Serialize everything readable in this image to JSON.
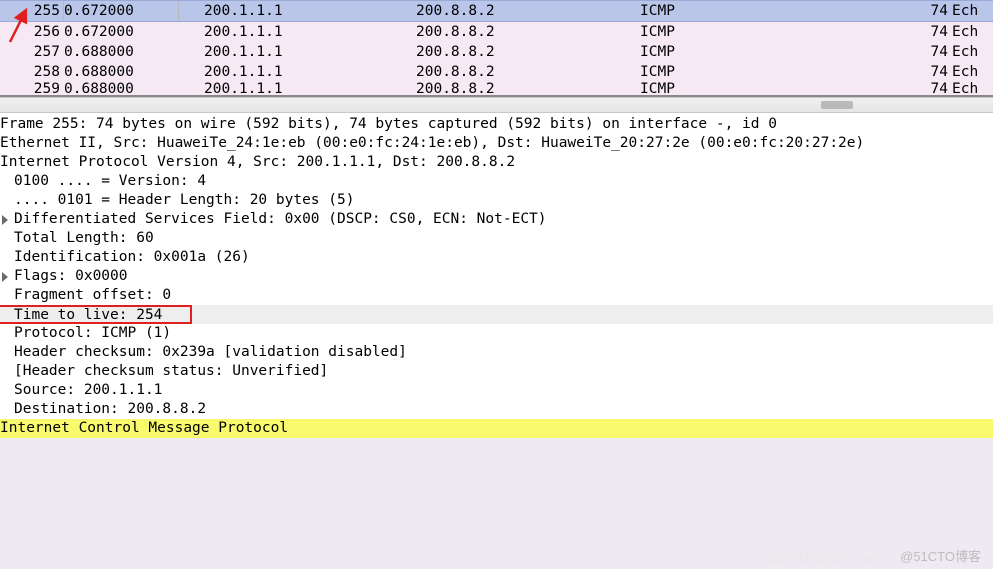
{
  "packet_list": {
    "rows": [
      {
        "no": "255",
        "time": "0.672000",
        "src": "200.1.1.1",
        "dst": "200.8.8.2",
        "proto": "ICMP",
        "len": "74",
        "info": "Ech",
        "selected": true
      },
      {
        "no": "256",
        "time": "0.672000",
        "src": "200.1.1.1",
        "dst": "200.8.8.2",
        "proto": "ICMP",
        "len": "74",
        "info": "Ech"
      },
      {
        "no": "257",
        "time": "0.688000",
        "src": "200.1.1.1",
        "dst": "200.8.8.2",
        "proto": "ICMP",
        "len": "74",
        "info": "Ech"
      },
      {
        "no": "258",
        "time": "0.688000",
        "src": "200.1.1.1",
        "dst": "200.8.8.2",
        "proto": "ICMP",
        "len": "74",
        "info": "Ech"
      },
      {
        "no": "259",
        "time": "0.688000",
        "src": "200.1.1.1",
        "dst": "200.8.8.2",
        "proto": "ICMP",
        "len": "74",
        "info": "Ech"
      }
    ]
  },
  "details": {
    "frame": "Frame 255: 74 bytes on wire (592 bits), 74 bytes captured (592 bits) on interface -, id 0",
    "eth": "Ethernet II, Src: HuaweiTe_24:1e:eb (00:e0:fc:24:1e:eb), Dst: HuaweiTe_20:27:2e (00:e0:fc:20:27:2e)",
    "ip": "Internet Protocol Version 4, Src: 200.1.1.1, Dst: 200.8.8.2",
    "ver": "0100 .... = Version: 4",
    "hlen": ".... 0101 = Header Length: 20 bytes (5)",
    "dsf": "Differentiated Services Field: 0x00 (DSCP: CS0, ECN: Not-ECT)",
    "tlen": "Total Length: 60",
    "id": "Identification: 0x001a (26)",
    "flags": "Flags: 0x0000",
    "frag": "Fragment offset: 0",
    "ttl": "Time to live: 254",
    "proto": "Protocol: ICMP (1)",
    "cksum": "Header checksum: 0x239a [validation disabled]",
    "ckst": "[Header checksum status: Unverified]",
    "src": "Source: 200.1.1.1",
    "dst": "Destination: 200.8.8.2",
    "icmp": "Internet Control Message Protocol"
  },
  "watermark": "@51CTO博客",
  "watermark2": "https://blog.csdn.ne"
}
